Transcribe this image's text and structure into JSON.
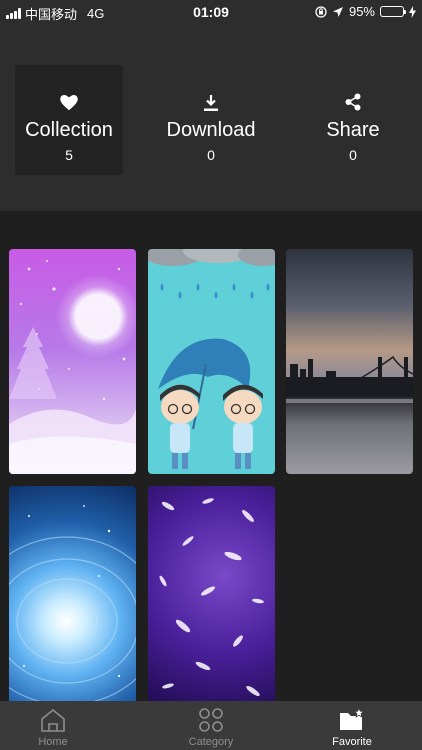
{
  "status_bar": {
    "carrier": "中国移动",
    "network": "4G",
    "time": "01:09",
    "battery_percent": "95%",
    "battery_level": 0.95
  },
  "stats": [
    {
      "label": "Collection",
      "count": "5",
      "icon": "heart-icon"
    },
    {
      "label": "Download",
      "count": "0",
      "icon": "download-icon"
    },
    {
      "label": "Share",
      "count": "0",
      "icon": "share-icon"
    }
  ],
  "wallpapers": [
    {
      "theme": "purple-moon"
    },
    {
      "theme": "cartoon-umbrella"
    },
    {
      "theme": "bridge-sunset"
    },
    {
      "theme": "blue-galaxy"
    },
    {
      "theme": "purple-feathers"
    }
  ],
  "tabbar": {
    "tabs": [
      {
        "label": "Home",
        "icon": "home-icon",
        "active": false
      },
      {
        "label": "Category",
        "icon": "category-icon",
        "active": false
      },
      {
        "label": "Favorite",
        "icon": "favorite-folder-icon",
        "active": true
      }
    ]
  },
  "colors": {
    "header_bg": "#2d2d2d",
    "content_bg": "#1f1f1f",
    "tabbar_bg": "#3a3a3a",
    "active_stat_bg": "#232323",
    "battery_green": "#4cd964"
  }
}
